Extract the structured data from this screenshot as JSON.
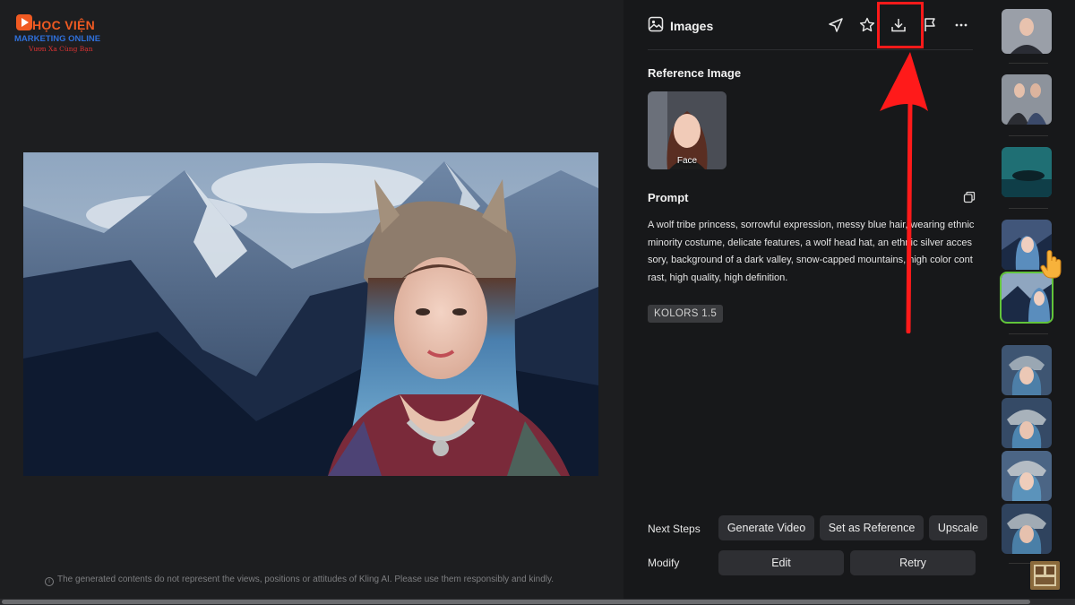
{
  "brand": {
    "line1": "HỌC VIỆN",
    "line2": "MARKETING ONLINE",
    "line3": "Vươn Xa Cùng Bạn",
    "accent": "#f05a22"
  },
  "canvas": {
    "image_name": "generated-image",
    "disclaimer": "The generated contents do not represent the views, positions or attitudes of Kling AI. Please use them responsibly and kindly."
  },
  "panel": {
    "title": "Images",
    "toolbar": [
      "send-icon",
      "star-icon",
      "download-icon",
      "flag-icon",
      "more-icon"
    ],
    "reference_title": "Reference Image",
    "reference_label": "Face",
    "prompt_title": "Prompt",
    "prompt_text": "A wolf tribe princess, sorrowful expression, messy blue hair, wearing ethnic minority costume, delicate features, a wolf head hat, an ethnic silver accessory, background of a dark valley, snow-capped mountains, high color contrast, high quality, high definition.",
    "model": "KOLORS 1.5",
    "next_steps_label": "Next Steps",
    "next_steps": [
      "Generate Video",
      "Set as Reference",
      "Upscale"
    ],
    "modify_label": "Modify",
    "modify": [
      "Edit",
      "Retry"
    ]
  },
  "annotation": {
    "highlight_color": "#ff1a1a",
    "target": "download-icon"
  }
}
